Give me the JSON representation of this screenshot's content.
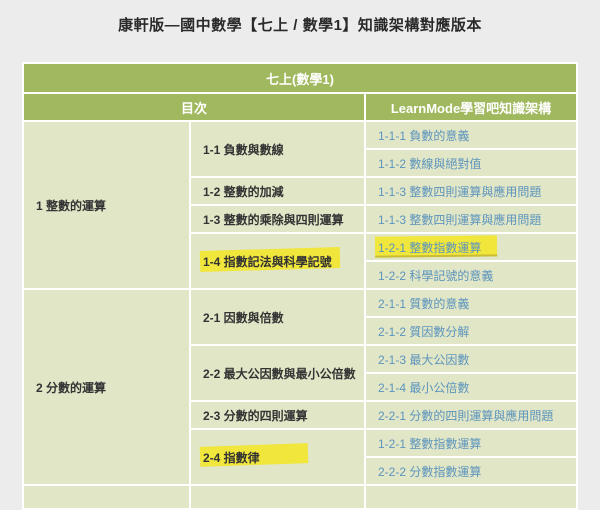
{
  "page": {
    "title": "康軒版—國中數學【七上 / 數學1】知識架構對應版本"
  },
  "colors": {
    "header_green": "#a0b85e",
    "cell_green": "#e1e6c7",
    "link_blue": "#5c94bd",
    "highlight_yellow": "#f0e63c",
    "page_background": "#ececec"
  },
  "table": {
    "title": "七上(數學1)",
    "columns": {
      "toc": "目次",
      "learnmode": "LearnMode學習吧知識架構"
    },
    "sections": [
      {
        "chapter": "1 整數的運算",
        "units": [
          {
            "label": "1-1 負數與數線",
            "links": [
              "1-1-1 負數的意義",
              "1-1-2 數線與絕對值"
            ],
            "highlighted": false
          },
          {
            "label": "1-2 整數的加減",
            "links": [
              "1-1-3 整數四則運算與應用問題"
            ],
            "highlighted": false
          },
          {
            "label": "1-3 整數的乘除與四則運算",
            "links": [
              "1-1-3 整數四則運算與應用問題"
            ],
            "highlighted": false
          },
          {
            "label": "1-4 指數記法與科學記號",
            "links": [
              "1-2-1 整數指數運算",
              "1-2-2 科學記號的意義"
            ],
            "highlighted": true,
            "highlighted_link_index": 0
          }
        ]
      },
      {
        "chapter": "2 分數的運算",
        "units": [
          {
            "label": "2-1 因數與倍數",
            "links": [
              "2-1-1 質數的意義",
              "2-1-2 質因數分解"
            ],
            "highlighted": false
          },
          {
            "label": "2-2 最大公因數與最小公倍數",
            "links": [
              "2-1-3 最大公因數",
              "2-1-4 最小公倍數"
            ],
            "highlighted": false
          },
          {
            "label": "2-3 分數的四則運算",
            "links": [
              "2-2-1 分數的四則運算與應用問題"
            ],
            "highlighted": false
          },
          {
            "label": "2-4 指數律",
            "links": [
              "1-2-1 整數指數運算",
              "2-2-2 分數指數運算"
            ],
            "highlighted": true
          }
        ]
      }
    ]
  }
}
